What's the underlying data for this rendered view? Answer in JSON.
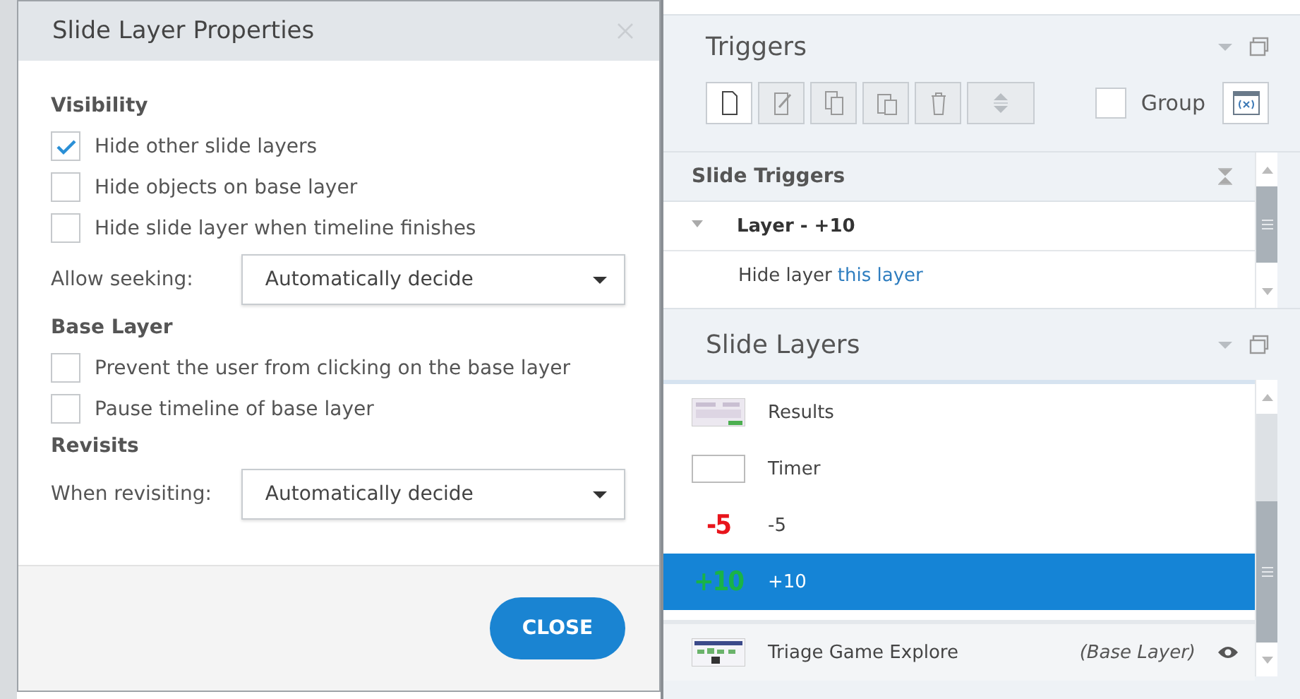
{
  "dialog": {
    "title": "Slide Layer Properties",
    "sections": [
      {
        "heading": "Visibility",
        "items": [
          {
            "kind": "checkbox",
            "label": "Hide other slide layers",
            "checked": true
          },
          {
            "kind": "checkbox",
            "label": "Hide objects on base layer",
            "checked": false
          },
          {
            "kind": "checkbox",
            "label": "Hide slide layer when timeline finishes",
            "checked": false
          },
          {
            "kind": "dropdown",
            "label": "Allow seeking:",
            "value": "Automatically decide"
          }
        ]
      },
      {
        "heading": "Base Layer",
        "items": [
          {
            "kind": "checkbox",
            "label": "Prevent the user from clicking on the base layer",
            "checked": false
          },
          {
            "kind": "checkbox",
            "label": "Pause timeline of base layer",
            "checked": false
          }
        ]
      },
      {
        "heading": "Revisits",
        "items": [
          {
            "kind": "dropdown",
            "label": "When revisiting:",
            "value": "Automatically decide"
          }
        ]
      }
    ],
    "button": "CLOSE"
  },
  "triggers": {
    "title": "Triggers",
    "group": {
      "label": "Group",
      "checked": false
    },
    "list": {
      "header": "Slide Triggers",
      "entries": [
        {
          "title": "Layer - +10",
          "expanded": true,
          "actions": [
            {
              "action": "Hide layer",
              "target": "this layer"
            }
          ]
        }
      ]
    }
  },
  "layers": {
    "title": "Slide Layers",
    "items": [
      {
        "name": "Results",
        "selected": false,
        "thumbnail": {
          "kind": "image"
        }
      },
      {
        "name": "Timer",
        "selected": false,
        "thumbnail": {
          "kind": "blank"
        }
      },
      {
        "name": "-5",
        "selected": false,
        "thumbnail": {
          "kind": "number",
          "text": "-5",
          "color": "#e8141b"
        }
      },
      {
        "name": "+10",
        "selected": true,
        "thumbnail": {
          "kind": "number",
          "text": "+10",
          "color": "#19b347"
        }
      }
    ],
    "base": {
      "name": "Triage Game Explore",
      "note": "(Base Layer)",
      "visible": true
    }
  }
}
